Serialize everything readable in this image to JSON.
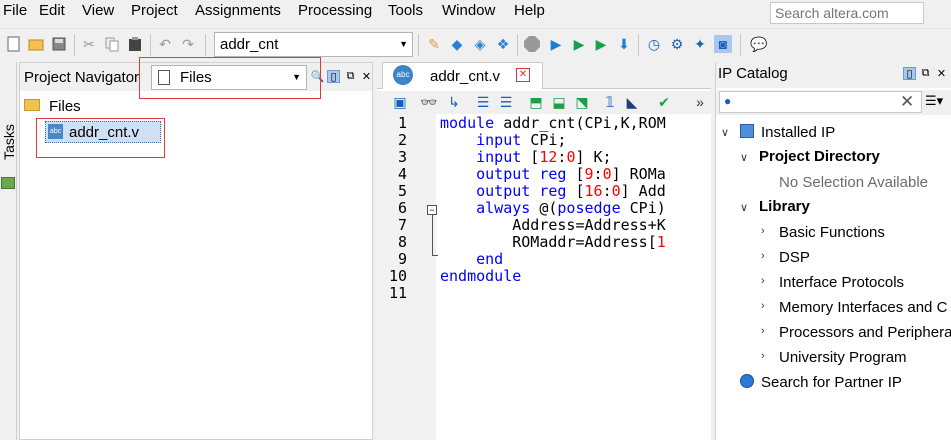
{
  "menu": [
    "File",
    "Edit",
    "View",
    "Project",
    "Assignments",
    "Processing",
    "Tools",
    "Window",
    "Help"
  ],
  "search": {
    "placeholder": "Search altera.com"
  },
  "toolbar": {
    "project_selector": "addr_cnt"
  },
  "tasks": {
    "label": "Tasks"
  },
  "navigator": {
    "title": "Project Navigator",
    "view_selector": "Files",
    "folder_label": "Files",
    "files": [
      "addr_cnt.v"
    ]
  },
  "editor": {
    "tab_label": "addr_cnt.v",
    "tab_icon_text": "abc",
    "line_numbers": [
      "1",
      "2",
      "3",
      "4",
      "5",
      "6",
      "7",
      "8",
      "9",
      "10",
      "11"
    ]
  },
  "ip_catalog": {
    "title": "IP Catalog",
    "installed_ip": "Installed IP",
    "project_directory": "Project Directory",
    "no_selection": "No Selection Available",
    "library": "Library",
    "library_items": [
      "Basic Functions",
      "DSP",
      "Interface Protocols",
      "Memory Interfaces and C",
      "Processors and Periphera",
      "University Program"
    ],
    "partner_ip": "Search for Partner IP"
  },
  "colors": {
    "keyword": "#0000ff",
    "number": "#ff0000",
    "highlight_box": "#e0393e",
    "selection": "#cfe0f5"
  },
  "icons": [
    "new-file-icon",
    "open-folder-icon",
    "save-icon",
    "cut-icon",
    "copy-icon",
    "paste-icon",
    "undo-icon",
    "redo-icon",
    "compile-icon",
    "stop-icon",
    "play-icon",
    "netlist-icon",
    "chip-planner-icon",
    "programmer-icon",
    "timing-icon",
    "help-icon"
  ]
}
